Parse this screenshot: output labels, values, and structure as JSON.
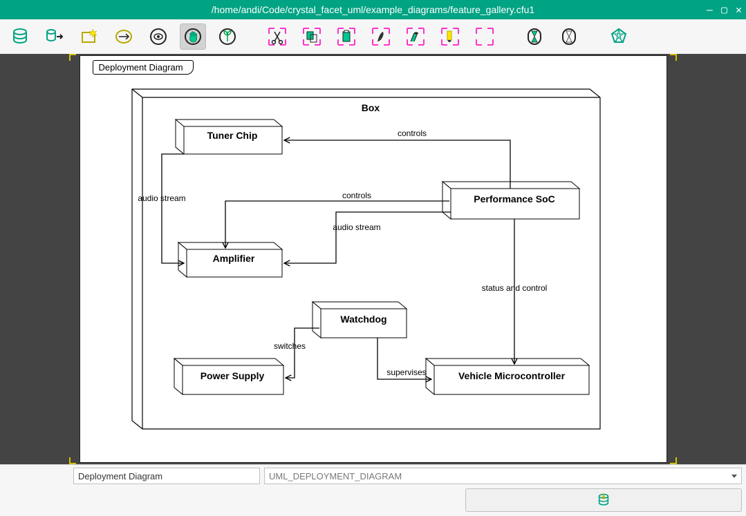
{
  "window": {
    "title": "/home/andi/Code/crystal_facet_uml/example_diagrams/feature_gallery.cfu1"
  },
  "toolbar": {
    "icons": [
      "database",
      "export",
      "new",
      "open",
      "view",
      "hand",
      "plant",
      "cut",
      "copy",
      "paste",
      "highlight",
      "underline",
      "marker",
      "select",
      "hourglass1",
      "hourglass2",
      "diamond"
    ]
  },
  "diagram": {
    "tab_label": "Deployment Diagram",
    "container_label": "Box",
    "nodes": {
      "tuner": "Tuner Chip",
      "amp": "Amplifier",
      "soc": "Performance SoC",
      "watchdog": "Watchdog",
      "power": "Power Supply",
      "vmc": "Vehicle Microcontroller"
    },
    "edges": {
      "controls1": "controls",
      "controls2": "controls",
      "audio1": "audio stream",
      "audio2": "audio stream",
      "status": "status and control",
      "switches": "switches",
      "supervises": "supervises"
    }
  },
  "properties": {
    "name": "Deployment Diagram",
    "type": "UML_DEPLOYMENT_DIAGRAM"
  }
}
